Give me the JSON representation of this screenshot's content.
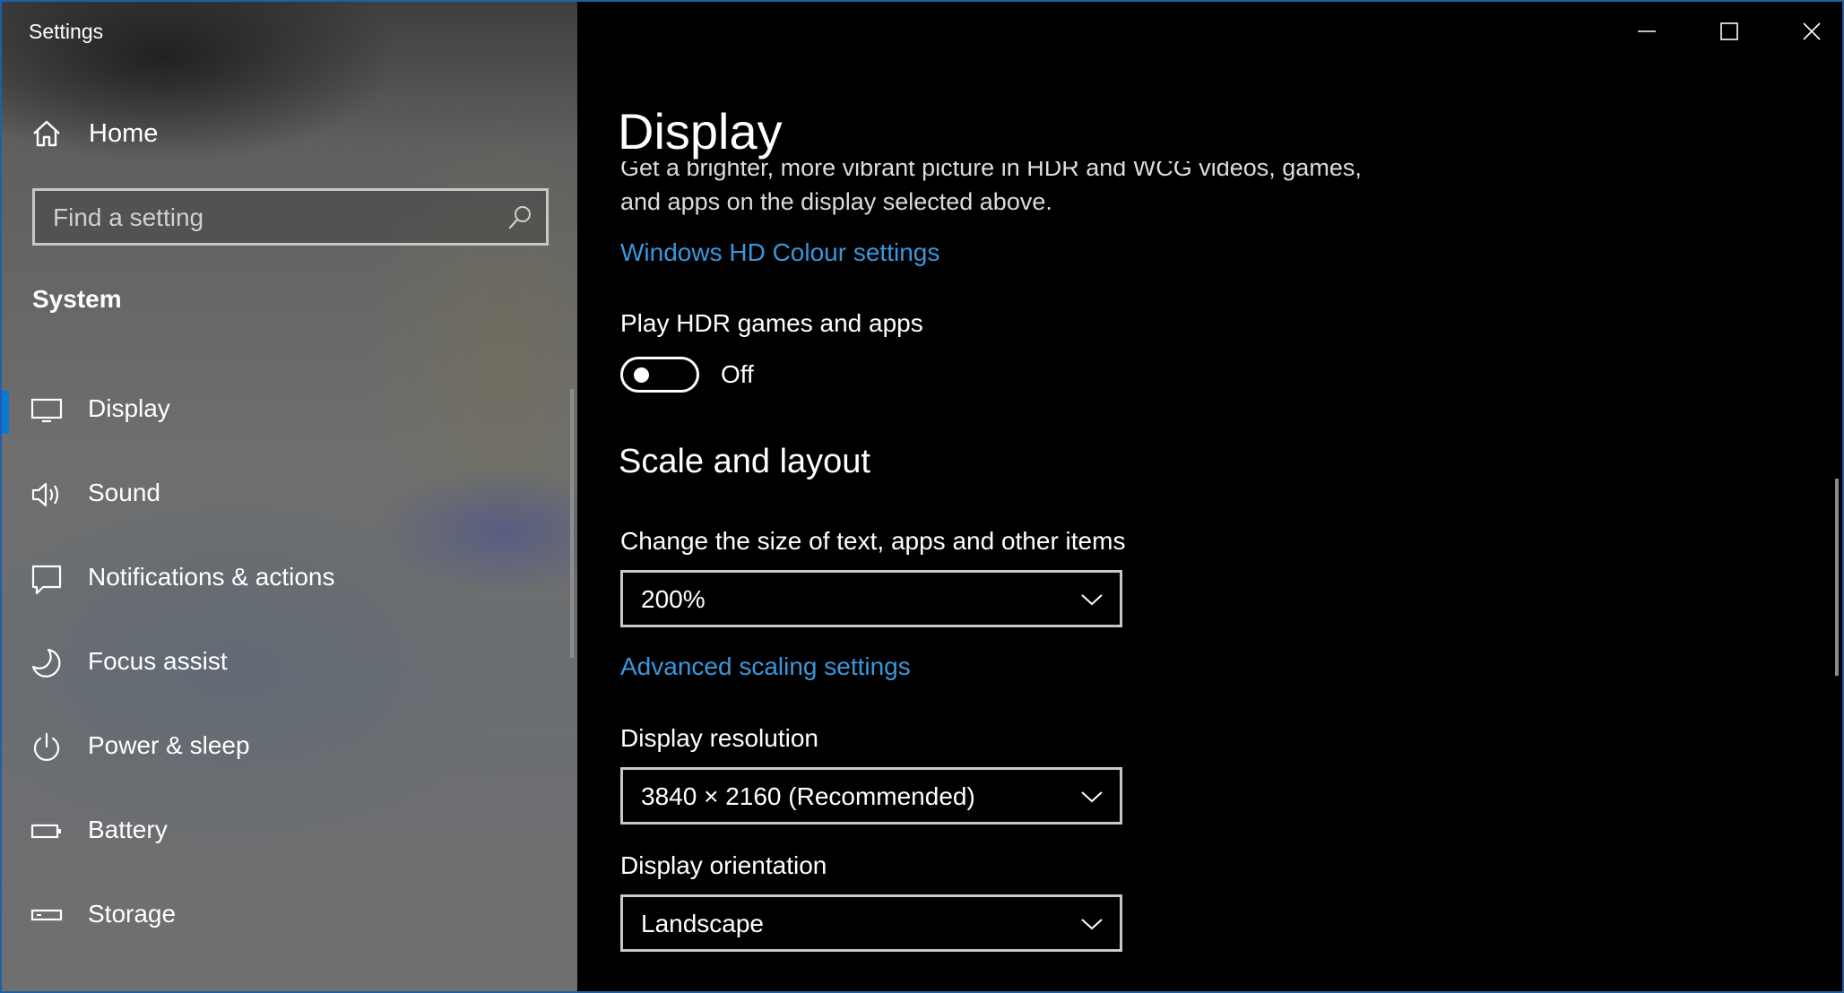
{
  "window": {
    "title": "Settings",
    "accent_color": "#0a78d4",
    "link_color": "#3a96dd",
    "border_color": "#1f5fa8"
  },
  "sidebar": {
    "home": {
      "label": "Home",
      "icon": "home-icon"
    },
    "search": {
      "placeholder": "Find a setting",
      "icon": "search-icon"
    },
    "section": "System",
    "items": [
      {
        "label": "Display",
        "icon": "monitor-icon",
        "active": true
      },
      {
        "label": "Sound",
        "icon": "speaker-icon",
        "active": false
      },
      {
        "label": "Notifications & actions",
        "icon": "notification-icon",
        "active": false
      },
      {
        "label": "Focus assist",
        "icon": "moon-icon",
        "active": false
      },
      {
        "label": "Power & sleep",
        "icon": "power-icon",
        "active": false
      },
      {
        "label": "Battery",
        "icon": "battery-icon",
        "active": false
      },
      {
        "label": "Storage",
        "icon": "storage-icon",
        "active": false
      }
    ]
  },
  "main": {
    "title": "Display",
    "hdr_description_line1": "Get a brighter, more vibrant picture in HDR and WCG videos, games,",
    "hdr_description_line2": "and apps on the display selected above.",
    "hd_colour_link": "Windows HD Colour settings",
    "play_hdr": {
      "label": "Play HDR games and apps",
      "state": "Off"
    },
    "scale_heading": "Scale and layout",
    "scale": {
      "label": "Change the size of text, apps and other items",
      "value": "200%"
    },
    "advanced_link": "Advanced scaling settings",
    "resolution": {
      "label": "Display resolution",
      "value": "3840 × 2160 (Recommended)"
    },
    "orientation": {
      "label": "Display orientation",
      "value": "Landscape"
    }
  }
}
